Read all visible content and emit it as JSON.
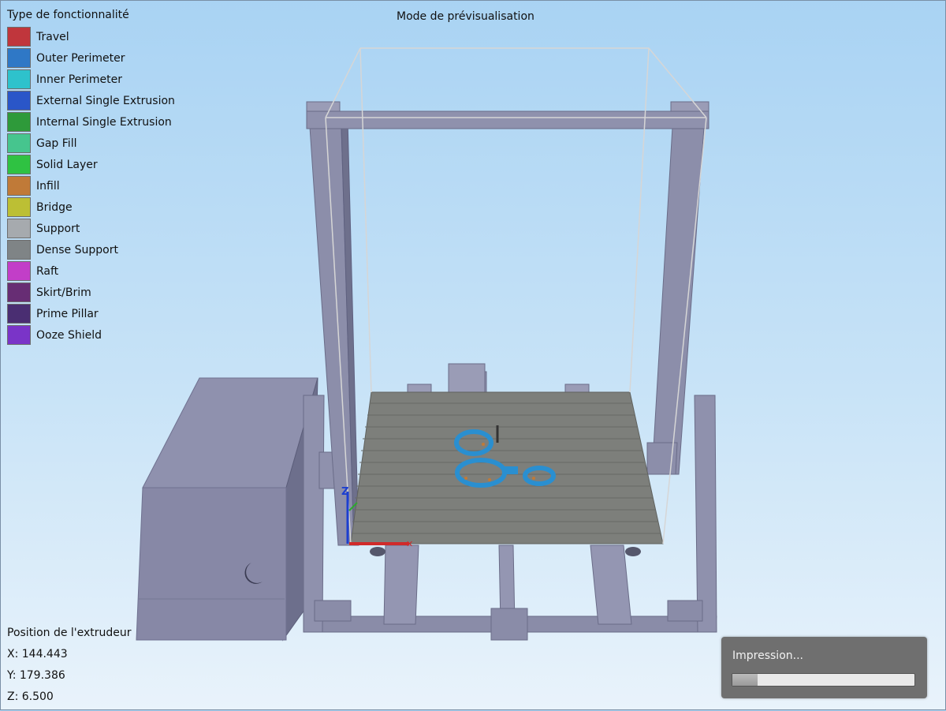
{
  "legend": {
    "title": "Type de fonctionnalité",
    "items": [
      {
        "label": "Travel",
        "color": "#c0363c"
      },
      {
        "label": "Outer Perimeter",
        "color": "#2f78c6"
      },
      {
        "label": "Inner Perimeter",
        "color": "#2ec2cc"
      },
      {
        "label": "External Single Extrusion",
        "color": "#2a56c8"
      },
      {
        "label": "Internal Single Extrusion",
        "color": "#2e9a3a"
      },
      {
        "label": "Gap Fill",
        "color": "#46c58e"
      },
      {
        "label": "Solid Layer",
        "color": "#2fc242"
      },
      {
        "label": "Infill",
        "color": "#c07a38"
      },
      {
        "label": "Bridge",
        "color": "#bcbf34"
      },
      {
        "label": "Support",
        "color": "#a6aaae"
      },
      {
        "label": "Dense Support",
        "color": "#7f8486"
      },
      {
        "label": "Raft",
        "color": "#c23ec8"
      },
      {
        "label": "Skirt/Brim",
        "color": "#672d74"
      },
      {
        "label": "Prime Pillar",
        "color": "#4a2e72"
      },
      {
        "label": "Ooze Shield",
        "color": "#7a34c8"
      }
    ]
  },
  "header": {
    "title": "Mode de prévisualisation"
  },
  "extruder": {
    "title": "Position de l'extrudeur",
    "x": "X: 144.443",
    "y": "Y: 179.386",
    "z": "Z: 6.500"
  },
  "progress": {
    "label": "Impression...",
    "value": 0.14
  },
  "axis": {
    "z_label": "Z"
  },
  "colors": {
    "frame": "#8a8ca8",
    "bed": "#7c7e7a",
    "print": "#2a8fd0"
  }
}
